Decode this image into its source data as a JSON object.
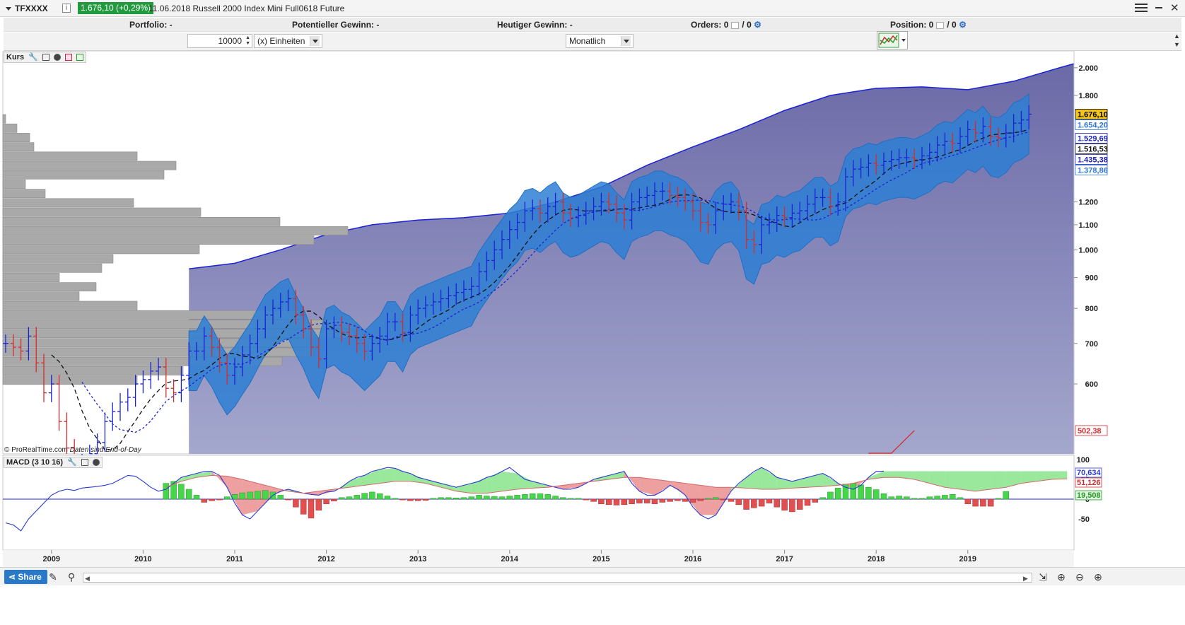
{
  "header": {
    "symbol": "TFXXXX",
    "info": "i",
    "price_badge": "1.676,10 (+0,29%)",
    "title": "11.06.2018 Russell 2000 Index Mini Full0618 Future"
  },
  "stats": {
    "portfolio_label": "Portfolio:",
    "portfolio_value": "-",
    "potential_label": "Potentieller Gewinn:",
    "potential_value": "-",
    "today_label": "Heutiger Gewinn:",
    "today_value": "-",
    "orders_label": "Orders:",
    "orders_value_1": "0",
    "orders_sep": "/",
    "orders_value_2": "0",
    "position_label": "Position:",
    "position_value_1": "0",
    "position_sep": "/",
    "position_value_2": "0"
  },
  "controls": {
    "quantity": "10000",
    "unit": "(x) Einheiten",
    "period": "Monatlich"
  },
  "panels": {
    "price_label": "Kurs",
    "macd_label": "MACD (3 10 16)",
    "watermark": "© ProRealTime.com",
    "watermark_note": "Daten sind End-of-Day"
  },
  "footer": {
    "share": "Share"
  },
  "colors": {
    "cloud_dark": "#6b6aa7",
    "cloud_light": "#a3a6cc",
    "band": "#2e7fd3",
    "up_bar": "#1a22d6",
    "down_bar": "#d32d2d",
    "macd_pos": "#45d64a",
    "macd_neg": "#e05050"
  },
  "chart_data": [
    {
      "type": "candlestick",
      "title": "Kurs",
      "period": "monthly",
      "y_scale": "log",
      "y_ticks": [
        "600",
        "700",
        "800",
        "900",
        "1.000",
        "1.100",
        "1.200",
        "2.000",
        "1.800"
      ],
      "x_labels": [
        "2009",
        "2010",
        "2011",
        "2012",
        "2013",
        "2014",
        "2015",
        "2016",
        "2017",
        "2018",
        "2019"
      ],
      "price_tags": [
        {
          "label": "1.676,10",
          "value": 1676.1,
          "style": "current"
        },
        {
          "label": "1.654,20",
          "value": 1654.2,
          "style": "blue"
        },
        {
          "label": "1.529,69",
          "value": 1529.69,
          "style": "navy"
        },
        {
          "label": "1.516,53",
          "value": 1516.53,
          "style": "black"
        },
        {
          "label": "1.435,38",
          "value": 1435.38,
          "style": "navy"
        },
        {
          "label": "1.378,86",
          "value": 1378.86,
          "style": "blue"
        },
        {
          "label": "502,38",
          "value": 502.38,
          "style": "red"
        }
      ],
      "series": [
        {
          "name": "Kurs",
          "x_start": "2008-07",
          "close": [
            700,
            690,
            680,
            720,
            650,
            580,
            600,
            520,
            470,
            430,
            440,
            460,
            480,
            520,
            540,
            560,
            570,
            600,
            610,
            630,
            640,
            590,
            580,
            620,
            680,
            680,
            720,
            690,
            650,
            620,
            640,
            670,
            700,
            740,
            780,
            800,
            820,
            830,
            780,
            740,
            690,
            660,
            740,
            750,
            730,
            720,
            700,
            680,
            700,
            720,
            760,
            760,
            730,
            780,
            800,
            810,
            820,
            830,
            840,
            850,
            860,
            870,
            920,
            960,
            1000,
            1040,
            1080,
            1110,
            1160,
            1170,
            1150,
            1180,
            1200,
            1150,
            1130,
            1140,
            1160,
            1180,
            1200,
            1190,
            1150,
            1120,
            1200,
            1220,
            1230,
            1250,
            1250,
            1230,
            1220,
            1200,
            1160,
            1110,
            1100,
            1160,
            1190,
            1200,
            1160,
            1040,
            1020,
            1100,
            1110,
            1140,
            1130,
            1150,
            1160,
            1190,
            1220,
            1220,
            1180,
            1200,
            1320,
            1360,
            1370,
            1390,
            1380,
            1400,
            1410,
            1420,
            1420,
            1410,
            1430,
            1450,
            1490,
            1510,
            1500,
            1540,
            1580,
            1560,
            1600,
            1540,
            1530,
            1560,
            1620,
            1640,
            1676.1
          ]
        },
        {
          "name": "Band upper",
          "x_start": "2010-07",
          "values": [
            930,
            950,
            1000,
            1060,
            1100,
            1120,
            1130,
            1150,
            1200,
            1270,
            1380,
            1480,
            1580,
            1700,
            1800,
            1850,
            1860,
            1840,
            1900,
            2000,
            2100
          ]
        },
        {
          "name": "Band lower",
          "x_start": "2017-12",
          "values": [
            430,
            460,
            502.38
          ]
        }
      ]
    },
    {
      "type": "bar",
      "title": "MACD (3 10 16)",
      "y_ticks": [
        "100",
        "50",
        "0",
        "-50"
      ],
      "price_tags": [
        {
          "label": "70,634",
          "value": 70.634,
          "style": "blue"
        },
        {
          "label": "51,126",
          "value": 51.126,
          "style": "red"
        },
        {
          "label": "19,508",
          "value": 19.508,
          "style": "green"
        }
      ],
      "series": [
        {
          "name": "MACD",
          "x_start": "2008-07",
          "values": [
            -60,
            -65,
            -80,
            -50,
            -30,
            -10,
            10,
            20,
            25,
            22,
            28,
            30,
            32,
            35,
            40,
            50,
            60,
            58,
            45,
            30,
            20,
            25,
            40,
            55,
            60,
            65,
            70,
            70,
            60,
            30,
            -10,
            -40,
            -50,
            -30,
            -10,
            10,
            20,
            25,
            20,
            15,
            12,
            10,
            18,
            20,
            30,
            45,
            55,
            60,
            70,
            75,
            80,
            78,
            70,
            65,
            55,
            50,
            45,
            40,
            35,
            30,
            35,
            40,
            45,
            55,
            60,
            70,
            80,
            65,
            50,
            45,
            40,
            35,
            30,
            25,
            25,
            30,
            40,
            50,
            55,
            60,
            65,
            70,
            40,
            20,
            10,
            10,
            20,
            35,
            25,
            10,
            -20,
            -40,
            -50,
            -40,
            -10,
            20,
            40,
            55,
            70,
            80,
            70,
            55,
            50,
            45,
            50,
            55,
            60,
            65,
            55,
            40,
            30,
            25,
            35,
            55,
            70,
            70.634
          ]
        },
        {
          "name": "Signal",
          "x_start": "2010-04",
          "values": [
            30,
            45,
            55,
            60,
            58,
            50,
            40,
            30,
            20,
            15,
            20,
            25,
            30,
            35,
            40,
            45,
            45,
            40,
            30,
            20,
            15,
            15,
            20,
            25,
            28,
            30,
            35,
            40,
            45,
            50,
            55,
            55,
            50,
            45,
            40,
            35,
            30,
            30,
            28,
            25,
            25,
            28,
            30,
            32,
            35,
            40,
            50,
            55,
            55,
            50,
            40,
            30,
            25,
            20,
            25,
            30,
            40,
            45,
            50,
            51.126
          ]
        },
        {
          "name": "Histogramm",
          "x_start": "2010-04",
          "values": [
            40,
            45,
            38,
            25,
            10,
            -8,
            -4,
            -2,
            6,
            12,
            16,
            18,
            20,
            22,
            18,
            10,
            -2,
            -20,
            -38,
            -48,
            -28,
            -12,
            -5,
            4,
            6,
            10,
            15,
            18,
            14,
            8,
            2,
            -2,
            -4,
            -4,
            -3,
            2,
            4,
            4,
            3,
            4,
            6,
            10,
            8,
            7,
            6,
            8,
            10,
            12,
            14,
            14,
            12,
            8,
            4,
            2,
            2,
            -2,
            -6,
            -12,
            -14,
            -15,
            -14,
            -12,
            -10,
            -10,
            -12,
            -8,
            -6,
            -4,
            -6,
            -8,
            -4,
            2,
            4,
            -2,
            -6,
            -14,
            -26,
            -22,
            -18,
            -10,
            -20,
            -28,
            -32,
            -26,
            -16,
            -8,
            4,
            18,
            28,
            38,
            40,
            36,
            30,
            24,
            14,
            6,
            8,
            6,
            2,
            2,
            6,
            8,
            10,
            12,
            4,
            -12,
            -18,
            -18,
            -18,
            2,
            19.508
          ]
        }
      ]
    }
  ]
}
